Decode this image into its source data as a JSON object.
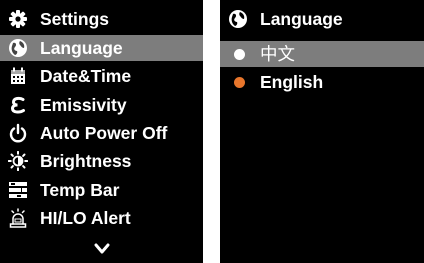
{
  "settings_menu": {
    "title": "Settings",
    "title_icon": "gear-icon",
    "items": [
      {
        "label": "Language",
        "icon": "globe-icon",
        "selected": true
      },
      {
        "label": "Date&Time",
        "icon": "calendar-icon",
        "selected": false
      },
      {
        "label": "Emissivity",
        "icon": "epsilon-icon",
        "selected": false
      },
      {
        "label": "Auto Power Off",
        "icon": "power-icon",
        "selected": false
      },
      {
        "label": "Brightness",
        "icon": "brightness-icon",
        "selected": false
      },
      {
        "label": "Temp Bar",
        "icon": "temp-bar-icon",
        "selected": false
      },
      {
        "label": "HI/LO Alert",
        "icon": "alarm-icon",
        "selected": false
      }
    ],
    "more_icon": "chevron-down-icon"
  },
  "language_menu": {
    "title": "Language",
    "title_icon": "globe-icon",
    "options": [
      {
        "label": "中文",
        "selected": true,
        "dot_color": "#ffffff"
      },
      {
        "label": "English",
        "selected": false,
        "dot_color": "#e8762c"
      }
    ]
  },
  "colors": {
    "background": "#000000",
    "highlight": "#7d7d7d",
    "text": "#ffffff",
    "accent": "#e8762c"
  }
}
